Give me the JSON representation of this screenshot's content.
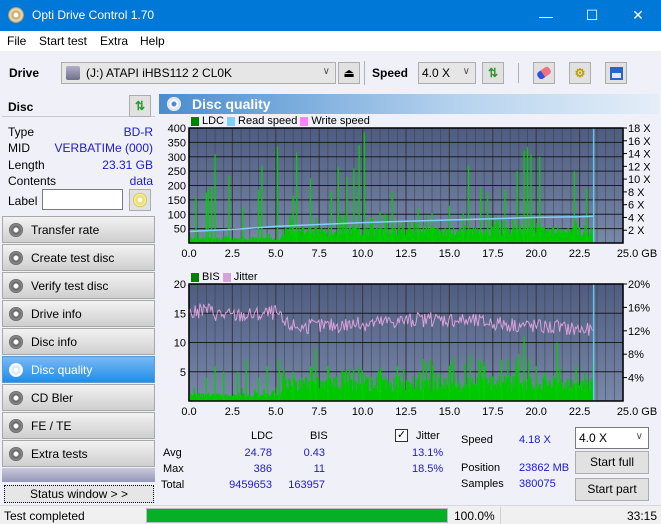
{
  "window": {
    "title": "Opti Drive Control 1.70",
    "minimize": "—",
    "maximize": "☐",
    "close": "✕"
  },
  "menu": [
    "File",
    "Start test",
    "Extra",
    "Help"
  ],
  "menu_underline": [
    "F",
    "S",
    "x",
    "H"
  ],
  "toolbar": {
    "drive_label": "Drive",
    "drive_value": "(J:)  ATAPI iHBS112  2 CL0K",
    "speed_label": "Speed",
    "speed_value": "4.0 X"
  },
  "disc": {
    "header": "Disc",
    "fields": [
      {
        "key": "Type",
        "value": "BD-R"
      },
      {
        "key": "MID",
        "value": "VERBATIMe (000)"
      },
      {
        "key": "Length",
        "value": "23.31 GB"
      },
      {
        "key": "Contents",
        "value": "data"
      }
    ],
    "label_key": "Label",
    "label_value": ""
  },
  "nav": [
    {
      "label": "Transfer rate",
      "active": false
    },
    {
      "label": "Create test disc",
      "active": false
    },
    {
      "label": "Verify test disc",
      "active": false
    },
    {
      "label": "Drive info",
      "active": false
    },
    {
      "label": "Disc info",
      "active": false
    },
    {
      "label": "Disc quality",
      "active": true
    },
    {
      "label": "CD Bler",
      "active": false
    },
    {
      "label": "FE / TE",
      "active": false
    },
    {
      "label": "Extra tests",
      "active": false
    }
  ],
  "status_window_label": "Status window > >",
  "panel_title": "Disc quality",
  "colors": {
    "ldc": "#00c800",
    "read_speed": "#80d0ff",
    "write_speed": "#ff80ff",
    "bis": "#00c800",
    "jitter": "#d8a0d8",
    "plot_bg": "#5a6a8e",
    "progress": "#06b025"
  },
  "chart_data": [
    {
      "type": "bar",
      "title": "LDC",
      "legend": [
        "LDC",
        "Read speed",
        "Write speed"
      ],
      "x_ticks": [
        "0.0",
        "2.5",
        "5.0",
        "7.5",
        "10.0",
        "12.5",
        "15.0",
        "17.5",
        "20.0",
        "22.5",
        "25.0 GB"
      ],
      "y_ticks": [
        "50",
        "100",
        "150",
        "200",
        "250",
        "300",
        "350",
        "400"
      ],
      "y2_ticks": [
        "2 X",
        "4 X",
        "6 X",
        "8 X",
        "10 X",
        "12 X",
        "14 X",
        "16 X",
        "18 X"
      ],
      "xlim": [
        0,
        25
      ],
      "ylim": [
        0,
        400
      ],
      "y2lim": [
        0,
        18
      ],
      "end_marker_gb": 23.31,
      "ldc_baseline": [
        [
          0,
          15
        ],
        [
          5.3,
          15
        ],
        [
          5.5,
          40
        ],
        [
          23.3,
          40
        ]
      ],
      "ldc_spikes": [
        [
          0.4,
          160
        ],
        [
          1.0,
          175
        ],
        [
          1.1,
          185
        ],
        [
          1.3,
          195
        ],
        [
          1.5,
          310
        ],
        [
          2.3,
          235
        ],
        [
          3.1,
          125
        ],
        [
          4.0,
          185
        ],
        [
          4.2,
          270
        ],
        [
          5.1,
          335
        ],
        [
          6.0,
          165
        ],
        [
          6.2,
          315
        ],
        [
          7.0,
          225
        ],
        [
          8.2,
          180
        ],
        [
          8.6,
          265
        ],
        [
          9.1,
          230
        ],
        [
          9.5,
          260
        ],
        [
          9.8,
          340
        ],
        [
          10.1,
          385
        ],
        [
          11.0,
          110
        ],
        [
          11.3,
          100
        ],
        [
          11.7,
          180
        ],
        [
          13.2,
          120
        ],
        [
          14.0,
          105
        ],
        [
          15.0,
          130
        ],
        [
          15.8,
          105
        ],
        [
          16.1,
          270
        ],
        [
          16.8,
          195
        ],
        [
          17.2,
          175
        ],
        [
          18.2,
          185
        ],
        [
          18.9,
          250
        ],
        [
          19.3,
          320
        ],
        [
          19.5,
          335
        ],
        [
          19.7,
          310
        ],
        [
          20.2,
          300
        ],
        [
          22.2,
          250
        ],
        [
          22.9,
          190
        ]
      ],
      "read_speed": [
        [
          0,
          1.8
        ],
        [
          1.5,
          2.0
        ],
        [
          3.0,
          2.2
        ],
        [
          5.0,
          2.6
        ],
        [
          7.5,
          2.9
        ],
        [
          10.0,
          3.2
        ],
        [
          12.5,
          3.4
        ],
        [
          15.0,
          3.6
        ],
        [
          17.5,
          3.8
        ],
        [
          20.0,
          4.0
        ],
        [
          22.5,
          4.1
        ],
        [
          23.31,
          4.2
        ]
      ]
    },
    {
      "type": "bar",
      "title": "BIS / Jitter",
      "legend": [
        "BIS",
        "Jitter"
      ],
      "x_ticks": [
        "0.0",
        "2.5",
        "5.0",
        "7.5",
        "10.0",
        "12.5",
        "15.0",
        "17.5",
        "20.0",
        "22.5",
        "25.0 GB"
      ],
      "y_ticks": [
        "5",
        "10",
        "15",
        "20"
      ],
      "y2_ticks": [
        "4%",
        "8%",
        "12%",
        "16%",
        "20%"
      ],
      "xlim": [
        0,
        25
      ],
      "ylim": [
        0,
        20
      ],
      "y2lim": [
        0,
        20
      ],
      "end_marker_gb": 23.31,
      "bis_baseline": [
        [
          0,
          1
        ],
        [
          5.3,
          1
        ],
        [
          5.5,
          3
        ],
        [
          23.3,
          3
        ]
      ],
      "bis_spikes": [
        [
          1.0,
          4
        ],
        [
          1.5,
          6
        ],
        [
          2.0,
          5
        ],
        [
          2.8,
          5
        ],
        [
          3.3,
          7
        ],
        [
          4.0,
          4
        ],
        [
          4.5,
          6
        ],
        [
          5.2,
          7
        ],
        [
          6.0,
          5
        ],
        [
          7.0,
          6
        ],
        [
          7.3,
          9
        ],
        [
          8.0,
          6
        ],
        [
          9.0,
          5
        ],
        [
          10.0,
          5
        ],
        [
          11.0,
          5
        ],
        [
          12.0,
          6
        ],
        [
          13.5,
          5
        ],
        [
          15.0,
          6
        ],
        [
          16.2,
          8
        ],
        [
          16.7,
          7
        ],
        [
          17.0,
          6
        ],
        [
          18.0,
          7
        ],
        [
          19.0,
          8
        ],
        [
          19.3,
          11
        ],
        [
          20.0,
          6
        ],
        [
          21.2,
          10
        ],
        [
          22.3,
          6
        ]
      ],
      "jitter": [
        [
          0,
          15.0
        ],
        [
          0.5,
          15.2
        ],
        [
          1.0,
          15.8
        ],
        [
          1.5,
          15.0
        ],
        [
          2.5,
          14.6
        ],
        [
          4.0,
          14.8
        ],
        [
          5.0,
          15.2
        ],
        [
          5.5,
          13.2
        ],
        [
          6.5,
          12.6
        ],
        [
          7.5,
          12.8
        ],
        [
          10.0,
          13.2
        ],
        [
          12.5,
          13.8
        ],
        [
          15.0,
          14.0
        ],
        [
          17.5,
          13.4
        ],
        [
          20.0,
          12.8
        ],
        [
          22.5,
          12.3
        ],
        [
          23.31,
          12.0
        ]
      ]
    }
  ],
  "stats": {
    "col_ldc": "LDC",
    "col_bis": "BIS",
    "jitter_label": "Jitter",
    "jitter_checked": true,
    "rows": [
      {
        "label": "Avg",
        "ldc": "24.78",
        "bis": "0.43",
        "jitter": "13.1%"
      },
      {
        "label": "Max",
        "ldc": "386",
        "bis": "11",
        "jitter": "18.5%"
      },
      {
        "label": "Total",
        "ldc": "9459653",
        "bis": "163957",
        "jitter": ""
      }
    ],
    "speed_label": "Speed",
    "speed_value": "4.18 X",
    "position_label": "Position",
    "position_value": "23862 MB",
    "samples_label": "Samples",
    "samples_value": "380075",
    "speed_select": "4.0 X",
    "start_full": "Start full",
    "start_part": "Start part"
  },
  "statusbar": {
    "text": "Test completed",
    "progress_pct": 100.0,
    "progress_text": "100.0%",
    "elapsed": "33:15"
  }
}
